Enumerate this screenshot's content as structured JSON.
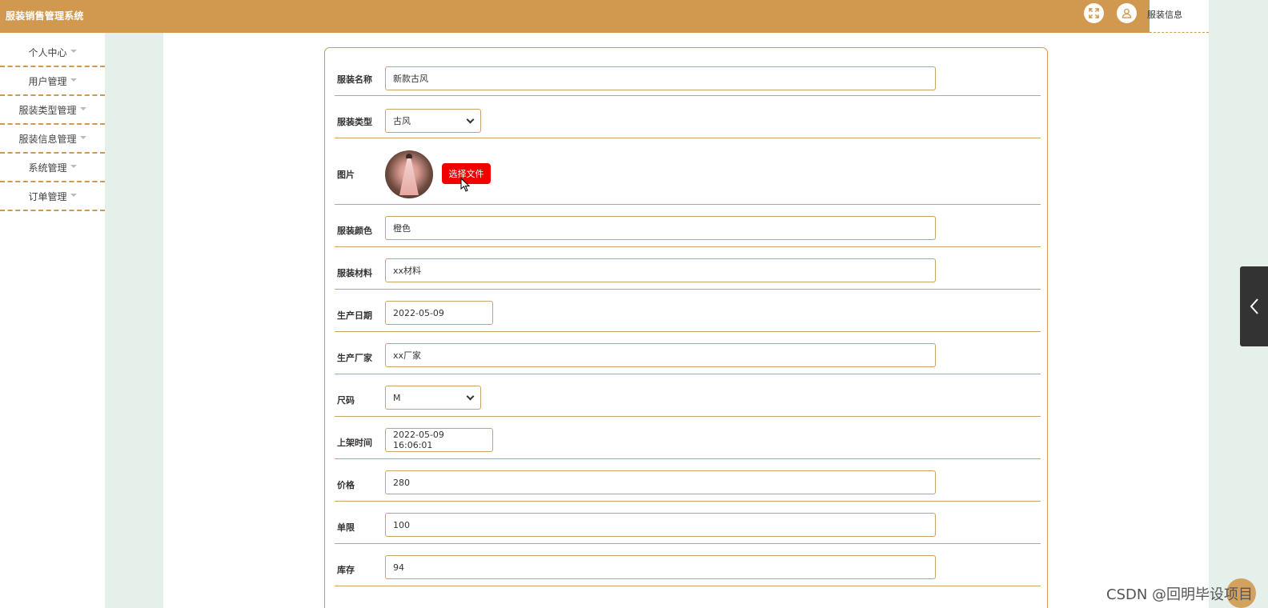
{
  "header": {
    "app_title": "服装销售管理系统",
    "tab_label": "服装信息",
    "fullscreen_icon": "expand-icon",
    "user_icon": "user-icon"
  },
  "sidebar": {
    "items": [
      {
        "label": "个人中心"
      },
      {
        "label": "用户管理"
      },
      {
        "label": "服装类型管理"
      },
      {
        "label": "服装信息管理"
      },
      {
        "label": "系统管理"
      },
      {
        "label": "订单管理"
      }
    ]
  },
  "form": {
    "name": {
      "label": "服装名称",
      "value": "新款古风"
    },
    "type": {
      "label": "服装类型",
      "value": "古风"
    },
    "image": {
      "label": "图片",
      "button": "选择文件"
    },
    "color": {
      "label": "服装颜色",
      "value": "橙色"
    },
    "material": {
      "label": "服装材料",
      "value": "xx材料"
    },
    "prod_date": {
      "label": "生产日期",
      "value": "2022-05-09"
    },
    "manufacturer": {
      "label": "生产厂家",
      "value": "xx厂家"
    },
    "size": {
      "label": "尺码",
      "value": "M"
    },
    "listed_time": {
      "label": "上架时间",
      "value": "2022-05-09 16:06:01"
    },
    "price": {
      "label": "价格",
      "value": "280"
    },
    "limit": {
      "label": "单限",
      "value": "100"
    },
    "stock": {
      "label": "库存",
      "value": "94"
    }
  },
  "watermark": "CSDN @回明毕设项目",
  "colors": {
    "accent": "#d0994f",
    "band": "#e6f0ea",
    "danger": "#f00000"
  }
}
